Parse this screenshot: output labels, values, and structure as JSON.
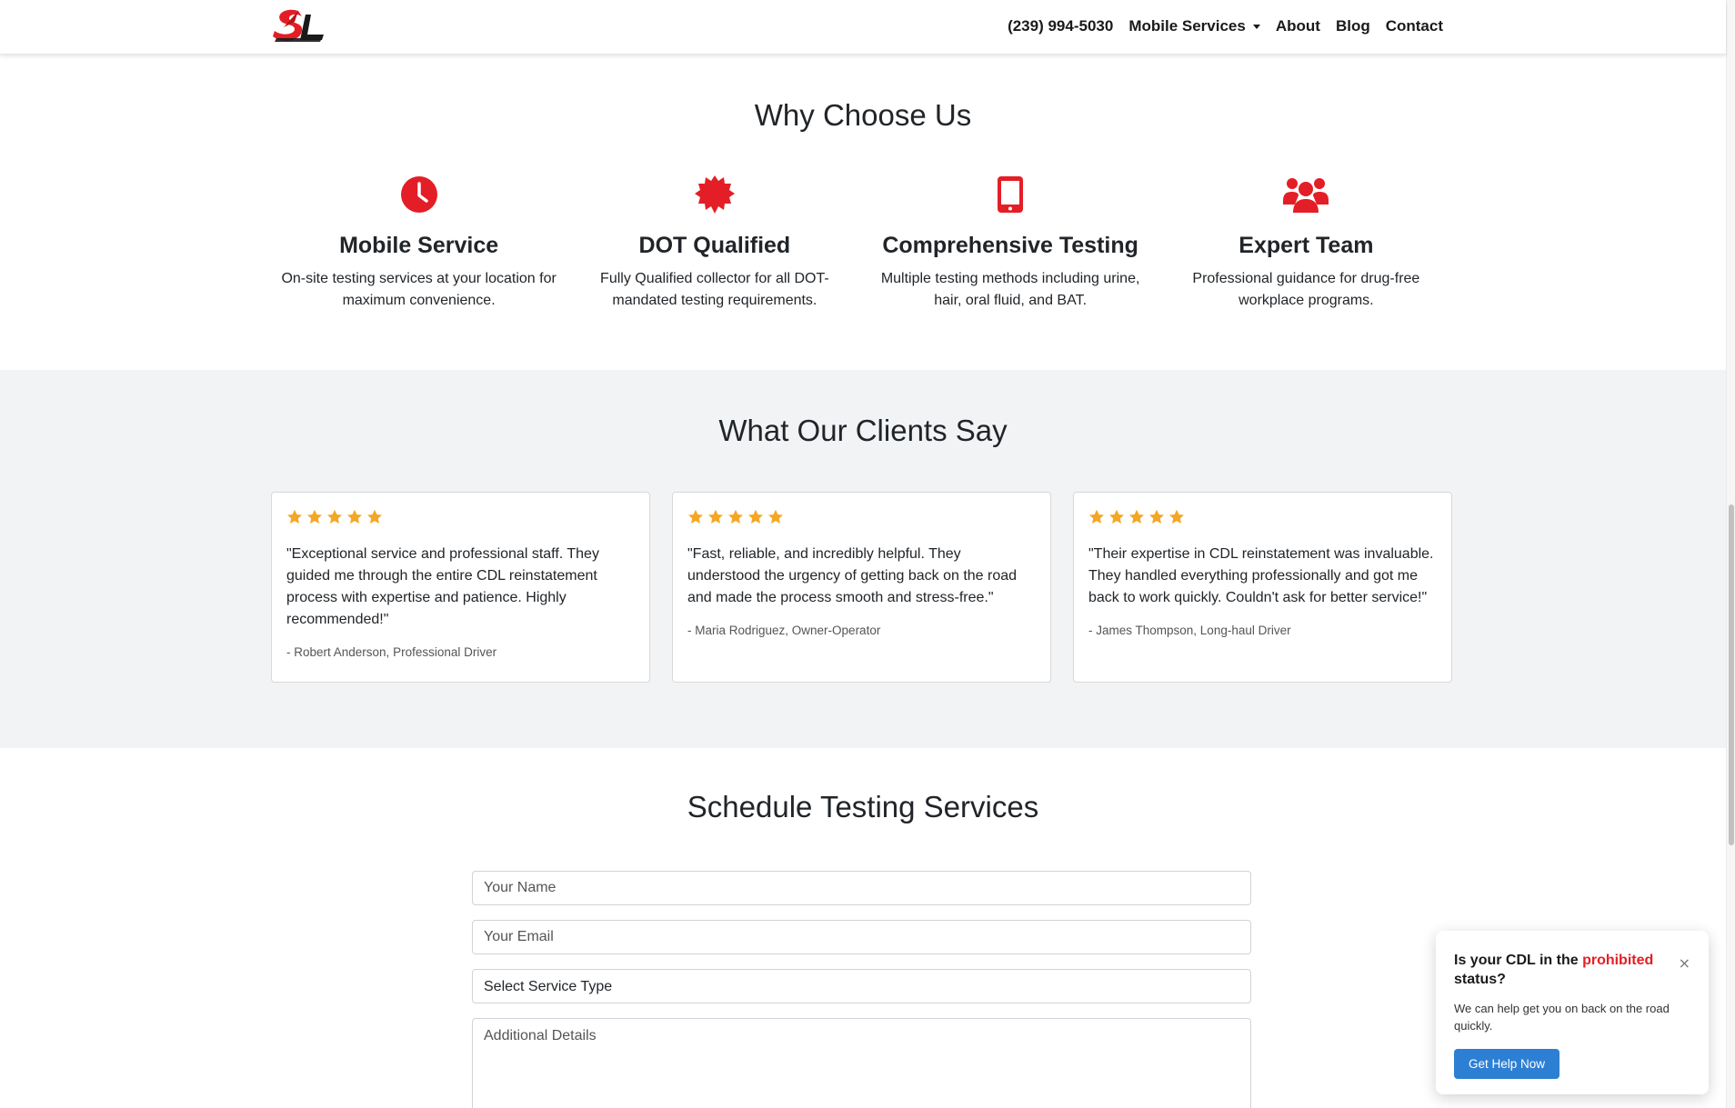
{
  "brand": {
    "logo_text": "SL",
    "accent_color": "#e41e26"
  },
  "nav": {
    "phone": "(239) 994-5030",
    "items": [
      {
        "label": "Mobile Services",
        "dropdown": true
      },
      {
        "label": "About"
      },
      {
        "label": "Blog"
      },
      {
        "label": "Contact"
      }
    ]
  },
  "why": {
    "title": "Why Choose Us",
    "features": [
      {
        "icon": "clock-icon",
        "title": "Mobile Service",
        "text": "On-site testing services at your location for maximum convenience."
      },
      {
        "icon": "certificate-icon",
        "title": "DOT Qualified",
        "text": "Fully Qualified collector for all DOT-mandated testing requirements."
      },
      {
        "icon": "tablet-icon",
        "title": "Comprehensive Testing",
        "text": "Multiple testing methods including urine, hair, oral fluid, and BAT."
      },
      {
        "icon": "users-icon",
        "title": "Expert Team",
        "text": "Professional guidance for drug-free workplace programs."
      }
    ]
  },
  "testimonials": {
    "title": "What Our Clients Say",
    "star_color": "#f5a623",
    "items": [
      {
        "rating": 5,
        "quote": "\"Exceptional service and professional staff. They guided me through the entire CDL reinstatement process with expertise and patience. Highly recommended!\"",
        "author": "- Robert Anderson, Professional Driver"
      },
      {
        "rating": 5,
        "quote": "\"Fast, reliable, and incredibly helpful. They understood the urgency of getting back on the road and made the process smooth and stress-free.\"",
        "author": "- Maria Rodriguez, Owner-Operator"
      },
      {
        "rating": 5,
        "quote": "\"Their expertise in CDL reinstatement was invaluable. They handled everything professionally and got me back to work quickly. Couldn't ask for better service!\"",
        "author": "- James Thompson, Long-haul Driver"
      }
    ]
  },
  "schedule": {
    "title": "Schedule Testing Services",
    "name_placeholder": "Your Name",
    "email_placeholder": "Your Email",
    "service_select_value": "Select Service Type",
    "details_placeholder": "Additional Details"
  },
  "popup": {
    "title_before": "Is your CDL in the ",
    "title_highlight": "prohibited",
    "title_after": " status?",
    "close_label": "×",
    "text": "We can help get you on back on the road quickly.",
    "button_label": "Get Help Now",
    "button_color": "#2d7fd3"
  }
}
